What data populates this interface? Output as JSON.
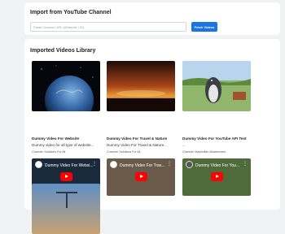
{
  "import": {
    "title": "Import from YouTube Channel",
    "input_placeholder": "Paste Channel URL (@handle / ID)",
    "input_value": "",
    "fetch_label": "Fetch Videos"
  },
  "library": {
    "title": "Imported Videos Library",
    "videos": [
      {
        "title": "Dummy Video For Website",
        "description": "Dummy video for all type of website...",
        "channel": "Channel: Solutions For All",
        "player_title": "Dummy Video For Websi...",
        "thumb_icon": "earth-in-space-thumbnail"
      },
      {
        "title": "Dummy Video For Travel & Nature",
        "description": "Dummy Video For Travel & Nature...",
        "channel": "Channel: Solutions For All",
        "player_title": "Dummy Video For Trav...",
        "thumb_icon": "sunset-ocean-thumbnail"
      },
      {
        "title": "Dummy Video For YouTube API Test",
        "description": "...",
        "channel": "Channel: Maximilian Mustermann",
        "player_title": "Dummy Video For You...",
        "thumb_icon": "penguin-cartoon-thumbnail"
      }
    ]
  },
  "colors": {
    "accent": "#1a73e8",
    "youtube_red": "#ff0000",
    "page_bg": "#f1f2f4"
  }
}
